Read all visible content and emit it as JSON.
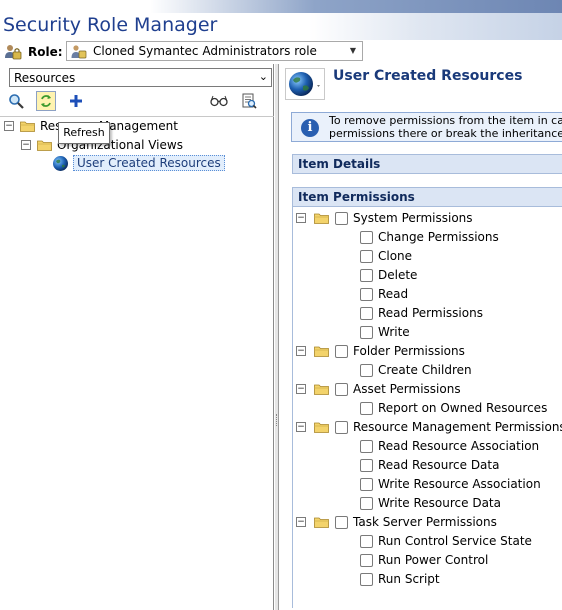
{
  "app": {
    "title": "Security Role Manager"
  },
  "role": {
    "label": "Role:",
    "selected": "Cloned Symantec Administrators role"
  },
  "left": {
    "dropdown": "Resources",
    "tooltip": "Refresh",
    "tree": [
      {
        "label": "Resource Management"
      },
      {
        "label": "Organizational Views"
      },
      {
        "label": "User Created Resources"
      }
    ]
  },
  "right": {
    "title": "User Created Resources",
    "info_line1": "To remove permissions from the item in ca",
    "info_line2": "permissions there or break the inheritance",
    "item_details": "Item Details",
    "item_permissions": "Item Permissions",
    "groups": [
      {
        "label": "System Permissions",
        "items": [
          "Change Permissions",
          "Clone",
          "Delete",
          "Read",
          "Read Permissions",
          "Write"
        ]
      },
      {
        "label": "Folder Permissions",
        "items": [
          "Create Children"
        ]
      },
      {
        "label": "Asset Permissions",
        "items": [
          "Report on Owned Resources"
        ]
      },
      {
        "label": "Resource Management Permissions",
        "items": [
          "Read Resource Association",
          "Read Resource Data",
          "Write Resource Association",
          "Write Resource Data"
        ]
      },
      {
        "label": "Task Server Permissions",
        "items": [
          "Run Control Service State",
          "Run Power Control",
          "Run Script"
        ]
      }
    ]
  },
  "colors": {
    "title": "#1f3f8f",
    "header_bg": "#dbe5f4",
    "selected_bg": "#e2eefc"
  },
  "icons": [
    "users-icon",
    "search-icon",
    "refresh-icon",
    "add-icon",
    "glasses-icon",
    "report-icon",
    "folder-icon",
    "globe-icon",
    "info-icon"
  ]
}
